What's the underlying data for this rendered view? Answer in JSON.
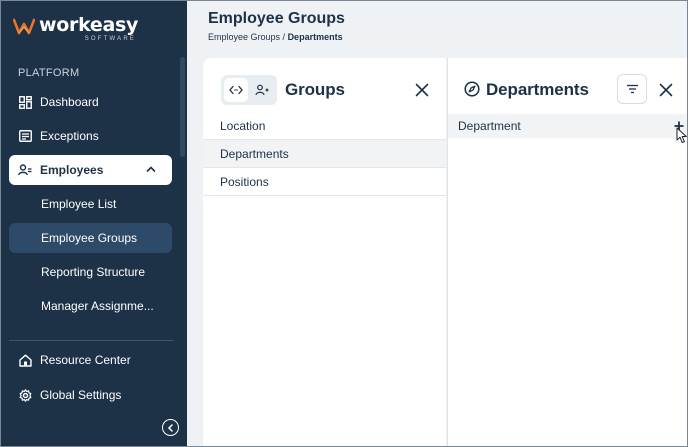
{
  "brand": {
    "name": "workeasy",
    "tagline": "SOFTWARE",
    "accent": "#e8742a"
  },
  "sidebar": {
    "section": "PLATFORM",
    "items": [
      {
        "label": "Dashboard",
        "icon": "dashboard-icon"
      },
      {
        "label": "Exceptions",
        "icon": "exceptions-icon"
      },
      {
        "label": "Employees",
        "icon": "employees-icon",
        "expanded": true
      }
    ],
    "sub_items": [
      {
        "label": "Employee List"
      },
      {
        "label": "Employee Groups",
        "selected": true
      },
      {
        "label": "Reporting Structure"
      },
      {
        "label": "Manager Assignme..."
      }
    ],
    "bottom_items": [
      {
        "label": "Resource Center",
        "icon": "home-icon"
      },
      {
        "label": "Global Settings",
        "icon": "gear-icon"
      }
    ]
  },
  "header": {
    "title": "Employee Groups",
    "breadcrumb_parent": "Employee Groups",
    "breadcrumb_sep": " / ",
    "breadcrumb_current": "Departments"
  },
  "groups_panel": {
    "title": "Groups",
    "rows": [
      "Location",
      "Departments",
      "Positions"
    ],
    "selected_index": 1
  },
  "departments_panel": {
    "title": "Departments",
    "column_header": "Department"
  },
  "colors": {
    "sidebar_bg": "#1d3147",
    "selected_sub": "#2d4a68",
    "text_dark": "#1d3147"
  }
}
